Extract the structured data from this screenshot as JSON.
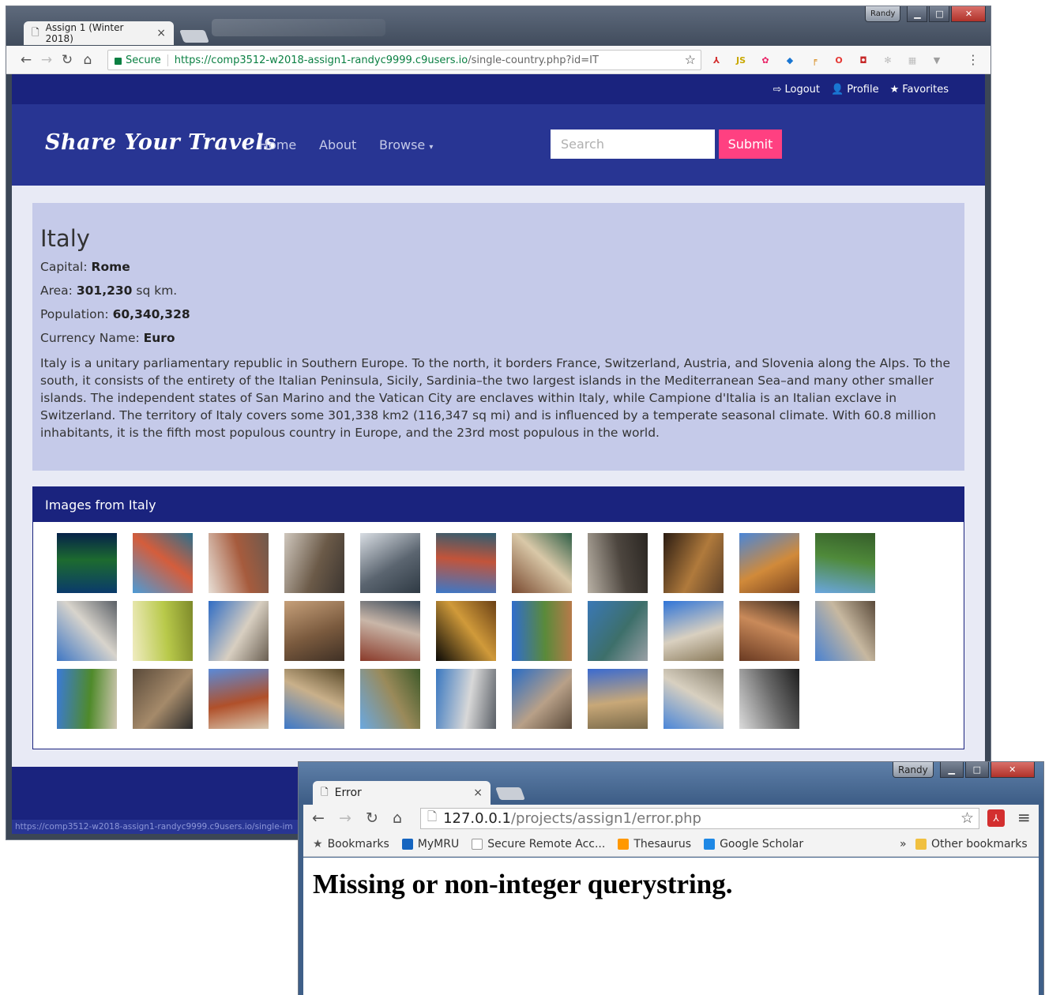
{
  "window1": {
    "tab_title": "Assign 1 (Winter 2018)",
    "user_badge": "Randy",
    "url": {
      "secure_label": "Secure",
      "host": "https://comp3512-w2018-assign1-randyc9999.c9users.io",
      "path": "/single-country.php?id=IT"
    },
    "status_url": "https://comp3512-w2018-assign1-randyc9999.c9users.io/single-im",
    "extensions": [
      {
        "icon": "acrobat-icon",
        "glyph": "⅄",
        "color": "#d32f2f"
      },
      {
        "icon": "js-icon",
        "glyph": "JS",
        "color": "#c9a800"
      },
      {
        "icon": "colorwheel-icon",
        "glyph": "✿",
        "color": "#e91e63"
      },
      {
        "icon": "gem-icon",
        "glyph": "◆",
        "color": "#1976d2"
      },
      {
        "icon": "eyedropper-icon",
        "glyph": "╒",
        "color": "#d68a1a"
      },
      {
        "icon": "opera-icon",
        "glyph": "O",
        "color": "#e53935"
      },
      {
        "icon": "red-square-icon",
        "glyph": "◘",
        "color": "#c62828"
      },
      {
        "icon": "gear-icon",
        "glyph": "✻",
        "color": "#bdbdbd"
      },
      {
        "icon": "grid-icon",
        "glyph": "▦",
        "color": "#bdbdbd"
      },
      {
        "icon": "vue-icon",
        "glyph": "▼",
        "color": "#9e9e9e"
      }
    ]
  },
  "site": {
    "user_links": {
      "logout": "Logout",
      "profile": "Profile",
      "favorites": "Favorites"
    },
    "brand": "Share Your Travels",
    "nav": {
      "home": "Home",
      "about": "About",
      "browse": "Browse"
    },
    "search_placeholder": "Search",
    "submit_label": "Submit",
    "colors": {
      "dark_indigo": "#1a237e",
      "indigo": "#283593",
      "light_indigo": "#c5cae9",
      "accent_pink": "#ff4081"
    }
  },
  "country": {
    "name": "Italy",
    "capital_label": "Capital:",
    "capital": "Rome",
    "area_label": "Area:",
    "area": "301,230",
    "area_unit": "sq km.",
    "population_label": "Population:",
    "population": "60,340,328",
    "currency_label": "Currency Name:",
    "currency": "Euro",
    "description": "Italy is a unitary parliamentary republic in Southern Europe. To the north, it borders France, Switzerland, Austria, and Slovenia along the Alps. To the south, it consists of the entirety of the Italian Peninsula, Sicily, Sardinia–the two largest islands in the Mediterranean Sea–and many other smaller islands. The independent states of San Marino and the Vatican City are enclaves within Italy, while Campione d'Italia is an Italian exclave in Switzerland. The territory of Italy covers some 301,338 km2 (116,347 sq mi) and is influenced by a temperate seasonal climate. With 60.8 million inhabitants, it is the fifth most populous country in Europe, and the 23rd most populous in the world."
  },
  "images_panel": {
    "heading": "Images from Italy",
    "thumbnails": [
      {
        "colors": [
          "#0a3a6b",
          "#1d6b2f",
          "#05224a"
        ]
      },
      {
        "colors": [
          "#4c9bd6",
          "#d45d3c",
          "#2a6f8d"
        ]
      },
      {
        "colors": [
          "#e8dfd6",
          "#a65b3d",
          "#6d5a4e"
        ]
      },
      {
        "colors": [
          "#cfc7bd",
          "#6b5a48",
          "#3c3530"
        ]
      },
      {
        "colors": [
          "#d8dde3",
          "#5b6570",
          "#2f3a44"
        ]
      },
      {
        "colors": [
          "#3c78c8",
          "#c2543a",
          "#2d5d72"
        ]
      },
      {
        "colors": [
          "#7a4a30",
          "#d9c8a8",
          "#2f5f47"
        ]
      },
      {
        "colors": [
          "#b9b1a5",
          "#4d463f",
          "#2a2622"
        ]
      },
      {
        "colors": [
          "#2b1c12",
          "#b07a3c",
          "#5d4028"
        ]
      },
      {
        "colors": [
          "#4a86d8",
          "#d18a3a",
          "#7a4420"
        ]
      },
      {
        "colors": [
          "#6aa6de",
          "#4f8a3a",
          "#355d2a"
        ]
      },
      {
        "colors": [
          "#3f77c4",
          "#d8d4cc",
          "#5a5f66"
        ]
      },
      {
        "colors": [
          "#f0ecc0",
          "#b8c94a",
          "#7e8a2a"
        ]
      },
      {
        "colors": [
          "#2f6cc4",
          "#d8cfc1",
          "#6a5f52"
        ]
      },
      {
        "colors": [
          "#c6a07a",
          "#7a5a3e",
          "#3f3025"
        ]
      },
      {
        "colors": [
          "#8a3a2a",
          "#c9b6a8",
          "#3a4a5a"
        ]
      },
      {
        "colors": [
          "#0b0906",
          "#d09a3a",
          "#6a4015"
        ]
      },
      {
        "colors": [
          "#2f6cd0",
          "#5a8a3a",
          "#b77a4a"
        ]
      },
      {
        "colors": [
          "#3a78b6",
          "#3d6f6a",
          "#9aa0a6"
        ]
      },
      {
        "colors": [
          "#2f74d8",
          "#d9d0c0",
          "#8a7a5a"
        ]
      },
      {
        "colors": [
          "#6a3a22",
          "#c98a5a",
          "#3a2a1e"
        ]
      },
      {
        "colors": [
          "#4a82d0",
          "#c7b8a0",
          "#5a4a3a"
        ]
      },
      {
        "colors": [
          "#3a7ad8",
          "#4f8a2a",
          "#d0c7b2"
        ]
      },
      {
        "colors": [
          "#5a4a3a",
          "#a58a6a",
          "#2a2a2a"
        ]
      },
      {
        "colors": [
          "#5a8ad8",
          "#b0502a",
          "#d8c8b0"
        ]
      },
      {
        "colors": [
          "#3c78c8",
          "#c9b08a",
          "#5a4a2a"
        ]
      },
      {
        "colors": [
          "#6aa8e0",
          "#9a8a5a",
          "#3f5a2a"
        ]
      },
      {
        "colors": [
          "#3a78c0",
          "#d8d8d8",
          "#5a5f66"
        ]
      },
      {
        "colors": [
          "#2a6cc4",
          "#b8a088",
          "#5a4a3a"
        ]
      },
      {
        "colors": [
          "#3a6ad0",
          "#c8a878",
          "#7a6a4a"
        ]
      },
      {
        "colors": [
          "#4a86d8",
          "#d8d0c0",
          "#8a8270"
        ]
      },
      {
        "colors": [
          "#dcdcdc",
          "#6a6a6a",
          "#1e1e1e"
        ]
      }
    ]
  },
  "window2": {
    "tab_title": "Error",
    "user_badge": "Randy",
    "url": {
      "host": "127.0.0.1",
      "path": "/projects/assign1/error.php"
    },
    "bookmarks": [
      {
        "label": "Bookmarks",
        "icon": "star-icon"
      },
      {
        "label": "MyMRU",
        "icon": "mymru-icon"
      },
      {
        "label": "Secure Remote Acc...",
        "icon": "page-icon"
      },
      {
        "label": "Thesaurus",
        "icon": "thesaurus-icon"
      },
      {
        "label": "Google Scholar",
        "icon": "scholar-icon"
      }
    ],
    "overflow": "»",
    "other_bookmarks": "Other bookmarks",
    "error_message": "Missing or non-integer querystring."
  }
}
